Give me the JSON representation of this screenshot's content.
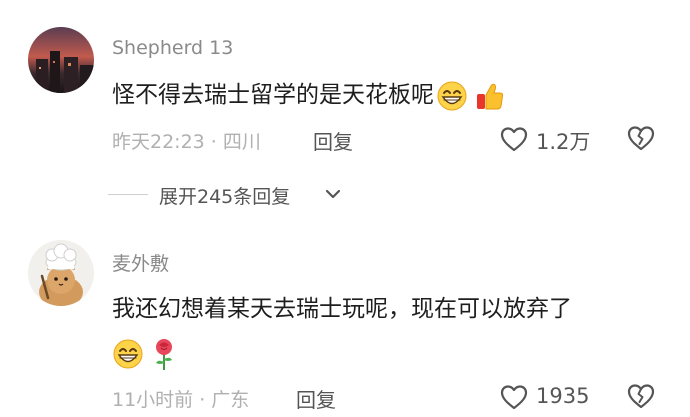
{
  "comments": [
    {
      "username": "Shepherd 13",
      "content": "怪不得去瑞士留学的是天花板呢",
      "emojis": [
        "grin-emoji",
        "thumbs-up-emoji"
      ],
      "meta": "昨天22:23 · 四川",
      "reply_label": "回复",
      "like_count": "1.2万",
      "expand_label": "展开245条回复"
    },
    {
      "username": "麦外敷",
      "content": "我还幻想着某天去瑞士玩呢，现在可以放弃了",
      "emojis": [
        "grin-emoji",
        "rose-emoji"
      ],
      "meta": "11小时前 · 广东",
      "reply_label": "回复",
      "like_count": "1935"
    }
  ],
  "colors": {
    "username": "#8a8a8a",
    "content": "#1e1e1e",
    "meta": "#b0b0b0",
    "action": "#555555"
  }
}
